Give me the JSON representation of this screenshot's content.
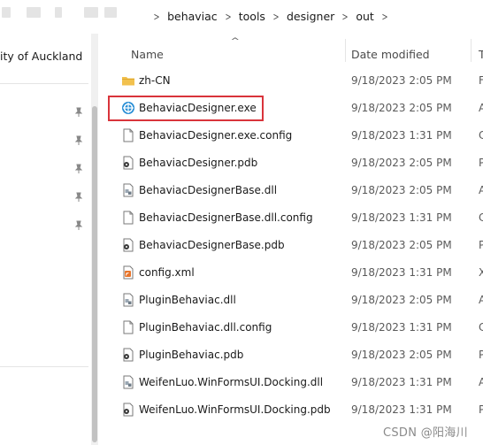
{
  "breadcrumb": [
    "behaviac",
    "tools",
    "designer",
    "out"
  ],
  "nav": {
    "label": "ity of Auckland"
  },
  "columns": {
    "name": "Name",
    "date": "Date modified",
    "type": "T"
  },
  "files": [
    {
      "name": "zh-CN",
      "date": "9/18/2023 2:05 PM",
      "type": "F",
      "icon": "folder-icon"
    },
    {
      "name": "BehaviacDesigner.exe",
      "date": "9/18/2023 2:05 PM",
      "type": "A",
      "icon": "exe-icon"
    },
    {
      "name": "BehaviacDesigner.exe.config",
      "date": "9/18/2023 1:31 PM",
      "type": "C",
      "icon": "file-icon"
    },
    {
      "name": "BehaviacDesigner.pdb",
      "date": "9/18/2023 2:05 PM",
      "type": "P",
      "icon": "pdb-icon"
    },
    {
      "name": "BehaviacDesignerBase.dll",
      "date": "9/18/2023 2:05 PM",
      "type": "A",
      "icon": "dll-icon"
    },
    {
      "name": "BehaviacDesignerBase.dll.config",
      "date": "9/18/2023 1:31 PM",
      "type": "C",
      "icon": "file-icon"
    },
    {
      "name": "BehaviacDesignerBase.pdb",
      "date": "9/18/2023 2:05 PM",
      "type": "P",
      "icon": "pdb-icon"
    },
    {
      "name": "config.xml",
      "date": "9/18/2023 1:31 PM",
      "type": "X",
      "icon": "xml-icon"
    },
    {
      "name": "PluginBehaviac.dll",
      "date": "9/18/2023 2:05 PM",
      "type": "A",
      "icon": "dll-icon"
    },
    {
      "name": "PluginBehaviac.dll.config",
      "date": "9/18/2023 1:31 PM",
      "type": "C",
      "icon": "file-icon"
    },
    {
      "name": "PluginBehaviac.pdb",
      "date": "9/18/2023 2:05 PM",
      "type": "P",
      "icon": "pdb-icon"
    },
    {
      "name": "WeifenLuo.WinFormsUI.Docking.dll",
      "date": "9/18/2023 1:31 PM",
      "type": "A",
      "icon": "dll-icon"
    },
    {
      "name": "WeifenLuo.WinFormsUI.Docking.pdb",
      "date": "9/18/2023 1:31 PM",
      "type": "P",
      "icon": "pdb-icon"
    }
  ],
  "watermark": "CSDN @阳海川",
  "colors": {
    "highlight": "#d9343b",
    "folder": "#f2c14e",
    "exe": "#2a8fd6"
  }
}
